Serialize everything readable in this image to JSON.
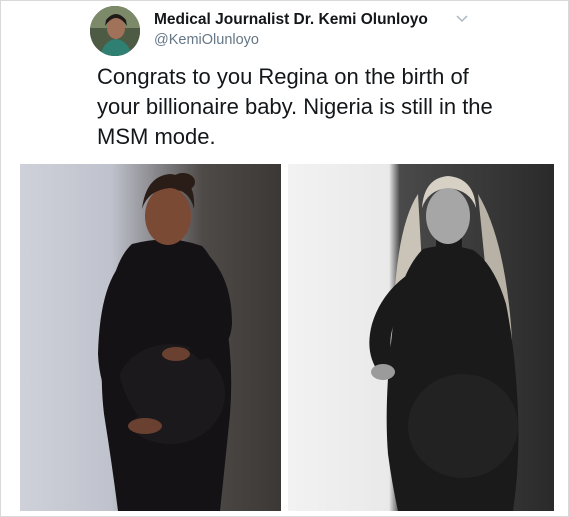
{
  "tweet": {
    "author_name": "Medical Journalist Dr. Kemi Olunloyo",
    "handle": "@KemiOlunloyo",
    "text": "Congrats to you Regina on the birth of your billionaire baby. Nigeria is still in the MSM mode.",
    "avatar_icon": "profile-photo",
    "menu_icon": "chevron-down-icon"
  },
  "media": {
    "photos": [
      {
        "description_icon": "photo-color-pregnant-woman-black-dress"
      },
      {
        "description_icon": "photo-bw-pregnant-woman-black-dress"
      }
    ]
  },
  "colors": {
    "text": "#14171a",
    "secondary_text": "#657786",
    "border": "#d9d9d9"
  }
}
